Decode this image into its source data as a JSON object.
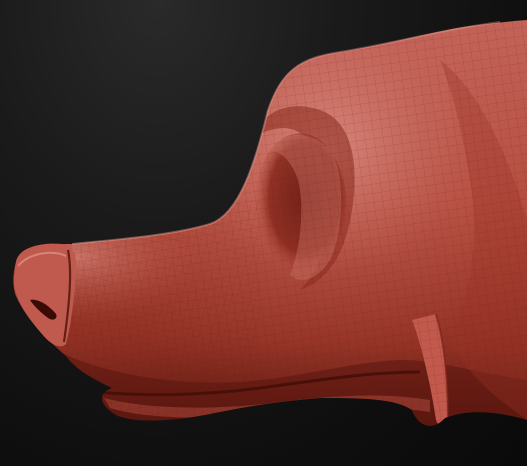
{
  "scene": {
    "subject": "sculpted-animal-head-side-view",
    "style": "clay-wireframe-render",
    "background_color": "#141414",
    "clay_color": "#b24a3c",
    "clay_highlight_color": "#d8857a",
    "clay_shadow_color": "#4e120c",
    "wireframe_color": "#5a1a12"
  }
}
